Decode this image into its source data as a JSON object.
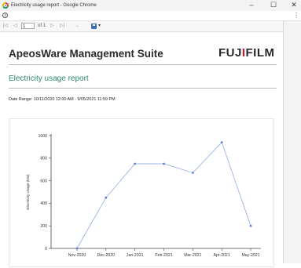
{
  "window": {
    "title": "Electricity usage report - Google Chrome",
    "minimize_glyph": "–",
    "maximize_glyph": "☐",
    "close_glyph": "✕"
  },
  "addressbar": {
    "info_glyph": "i",
    "menu_glyph": "⋮"
  },
  "viewer_toolbar": {
    "first_glyph": "|◁",
    "prev_glyph": "◁",
    "page_value": "1",
    "page_of": "of 1",
    "next_glyph": "▷",
    "last_glyph": "▷|",
    "back_glyph": "←",
    "export_dropdown_glyph": "▾"
  },
  "report": {
    "suite_title": "ApeosWare Management Suite",
    "logo_text_before": "FUJ",
    "logo_text_i": "I",
    "logo_text_after": "FILM",
    "title": "Electricity usage report",
    "date_range": "Date Range: 10/11/2020 12:00 AM - 9/05/2021 11:59 PM"
  },
  "colors": {
    "report_title": "#2e8b6a",
    "logo_accent": "#d3142d",
    "series_line": "#9fb4e6",
    "series_marker": "#5b7fd4"
  },
  "chart_data": {
    "type": "line",
    "title": "",
    "xlabel": "",
    "ylabel": "Electricity Usage (kW)",
    "categories": [
      "Nov-2020",
      "Dec-2020",
      "Jan-2021",
      "Feb-2021",
      "Mar-2021",
      "Apr-2021",
      "May-2021"
    ],
    "series": [
      {
        "values": [
          0,
          450,
          750,
          750,
          670,
          940,
          200
        ]
      }
    ],
    "ylim": [
      0,
      1000
    ],
    "yticks": [
      0,
      200,
      400,
      600,
      800,
      1000
    ],
    "grid": false,
    "legend": "none"
  }
}
